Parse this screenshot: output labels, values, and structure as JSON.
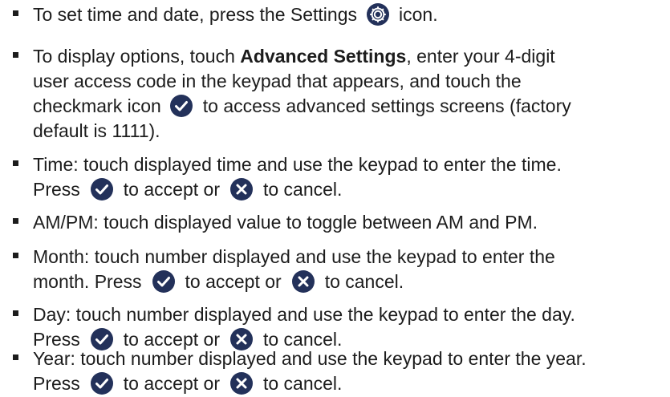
{
  "colors": {
    "text": "#1c1c1c",
    "icon_fill": "#23315a",
    "icon_glyph": "#ffffff"
  },
  "icons": {
    "settings": "gear-icon",
    "accept": "checkmark-icon",
    "cancel": "cancel-x-icon"
  },
  "items": [
    {
      "lines": [
        {
          "a": "To set time and date, press the Settings",
          "b": "icon."
        }
      ]
    },
    {
      "lines": [
        {
          "a": "To display options, touch",
          "bold": "Advanced Settings",
          "b": ", enter your 4-digit"
        },
        {
          "a": "user access code in the keypad that appears, and touch the"
        },
        {
          "a": "checkmark icon",
          "b": "to access advanced settings screens (factory"
        },
        {
          "a": "default is 1111)."
        }
      ]
    },
    {
      "lines": [
        {
          "a": "Time: touch displayed time and use the keypad to enter the time."
        },
        {
          "a": "Press",
          "b": "to accept or",
          "c": "to cancel."
        }
      ]
    },
    {
      "lines": [
        {
          "a": "AM/PM: touch displayed value to toggle between AM and PM."
        }
      ]
    },
    {
      "lines": [
        {
          "a": "Month: touch number displayed and use the keypad to enter the"
        },
        {
          "a": "month. Press",
          "b": "to accept or",
          "c": "to cancel."
        }
      ]
    },
    {
      "lines": [
        {
          "a": "Day: touch number displayed and use the keypad to enter the day."
        },
        {
          "a": "Press",
          "b": "to accept or",
          "c": "to cancel."
        }
      ]
    },
    {
      "lines": [
        {
          "a": "Year: touch number displayed and use the keypad to enter the year."
        },
        {
          "a": "Press",
          "b": "to accept or",
          "c": "to cancel."
        }
      ]
    }
  ]
}
